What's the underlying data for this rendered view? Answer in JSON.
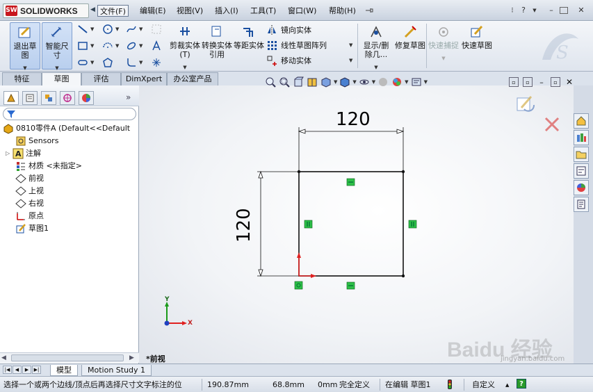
{
  "app": {
    "logo_text": "SOLIDWORKS",
    "logo_badge": "SW",
    "brand_color": "#c8161d"
  },
  "menu": [
    "文件(F)",
    "编辑(E)",
    "视图(V)",
    "插入(I)",
    "工具(T)",
    "窗口(W)",
    "帮助(H)"
  ],
  "window_controls": {
    "help": "?",
    "minimize": "–",
    "restore": "▫",
    "close": "✕"
  },
  "ribbon": {
    "exit_sketch": "退出草图",
    "smart_dim": "智能尺寸",
    "trim": "剪裁实体(T)",
    "convert": "转换实体引用",
    "offset": "等距实体",
    "mirror": "镜向实体",
    "linear_pattern": "线性草图阵列",
    "move": "移动实体",
    "display_delete": "显示/删除几...",
    "repair": "修复草图",
    "quick_snap": "快速捕捉",
    "rapid_sketch": "快速草图"
  },
  "command_tabs": [
    "特征",
    "草图",
    "评估",
    "DimXpert",
    "办公室产品"
  ],
  "feature_tree": {
    "root": "0810零件A  (Default<<Default",
    "items": [
      "Sensors",
      "注解",
      "材质 <未指定>",
      "前视",
      "上视",
      "右视",
      "原点",
      "草图1"
    ]
  },
  "sketch": {
    "dim_horizontal": "120",
    "dim_vertical": "120",
    "view_label": "*前视"
  },
  "triad": {
    "x": "X",
    "y": "Y"
  },
  "bottom_tabs": [
    "模型",
    "Motion Study 1"
  ],
  "watermark": {
    "text": "Baidu 经验",
    "url": "jingyan.baidu.com"
  },
  "status": {
    "message": "选择一个或两个边线/顶点后再选择尺寸文字标注的位",
    "x": "190.87mm",
    "y": "68.8mm",
    "z": "0mm",
    "state": "完全定义",
    "editing": "在编辑 草图1",
    "custom": "自定义"
  }
}
